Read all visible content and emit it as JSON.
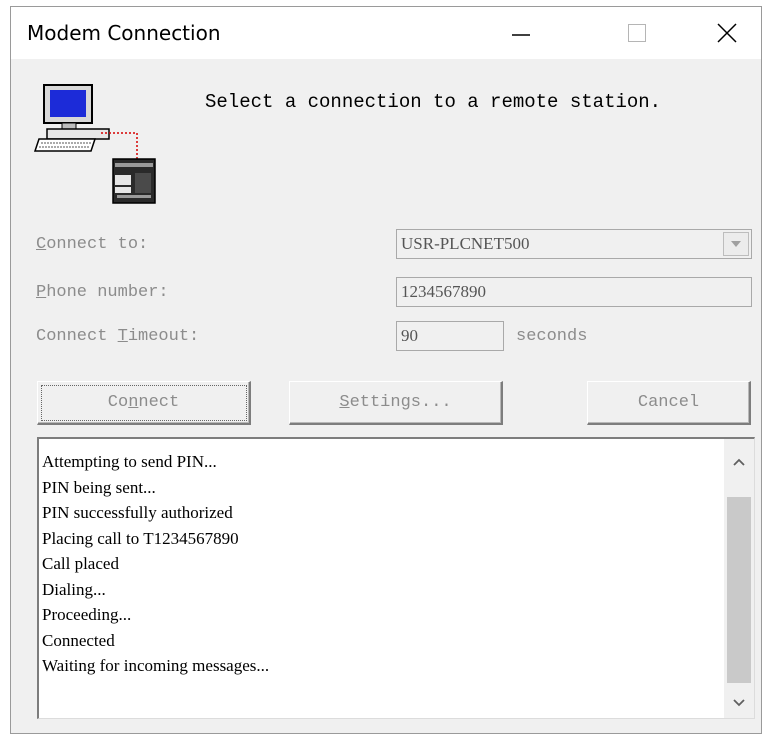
{
  "window": {
    "title": "Modem Connection",
    "controls": {
      "minimize": "minimize-icon",
      "maximize": "maximize-icon",
      "close": "close-icon"
    }
  },
  "header": {
    "prompt": "Select a connection to a remote station.",
    "illustration": "computer-plc-connection-icon"
  },
  "form": {
    "connect_to": {
      "label_first": "C",
      "label_rest": "onnect to:",
      "value": "USR-PLCNET500"
    },
    "phone_number": {
      "label_first": "P",
      "label_rest": "hone number:",
      "value": "1234567890"
    },
    "timeout": {
      "label_pre": "Connect ",
      "label_u": "T",
      "label_rest": "imeout:",
      "value": "90",
      "unit": "seconds"
    }
  },
  "buttons": {
    "connect": {
      "pre": "Co",
      "u": "n",
      "post": "nect"
    },
    "settings": {
      "pre": "",
      "u": "S",
      "post": "ettings..."
    },
    "cancel": {
      "label": "Cancel"
    }
  },
  "log": {
    "lines": [
      "Attempting to send PIN...",
      "PIN being sent...",
      "PIN successfully authorized",
      "Placing call to T1234567890",
      "Call placed",
      "Dialing...",
      "Proceeding...",
      "Connected",
      "Waiting for incoming messages..."
    ]
  },
  "colors": {
    "window_bg": "#f0f0f0",
    "disabled_text": "#8c8c8c",
    "titlebar_bg": "#ffffff"
  }
}
